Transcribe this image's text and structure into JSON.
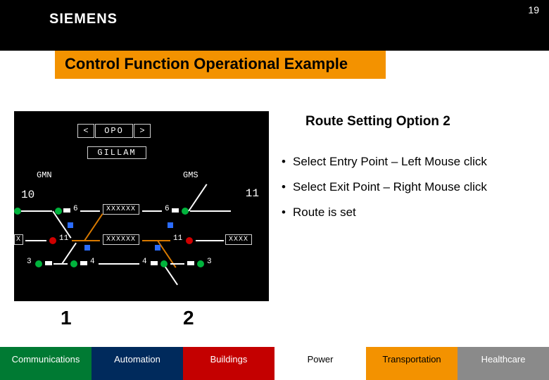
{
  "page_number": "19",
  "logo_text": "SIEMENS",
  "title": "Control Function Operational Example",
  "right": {
    "title": "Route Setting Option 2",
    "bullets": [
      "Select Entry Point – Left Mouse click",
      "Select Exit  Point – Right Mouse click",
      "Route is set"
    ]
  },
  "sim": {
    "prev": "<",
    "opo": "OPO",
    "next": ">",
    "station": "GILLAM",
    "gmn": "GMN",
    "gms": "GMS",
    "sig10": "10",
    "sig11": "11",
    "label6a": "6",
    "label6b": "6",
    "label11a": "11",
    "label11b": "11",
    "label3a": "3",
    "label4a": "4",
    "label4b": "4",
    "label3b": "3",
    "xxxx1": "XXXXXX",
    "xxxx2": "XXXXXX",
    "xxxx3": "XXXX",
    "xbox": "X",
    "callout1": "1",
    "callout2": "2"
  },
  "footer": {
    "communications": "Communications",
    "automation": "Automation",
    "buildings": "Buildings",
    "power": "Power",
    "transportation": "Transportation",
    "healthcare": "Healthcare"
  }
}
